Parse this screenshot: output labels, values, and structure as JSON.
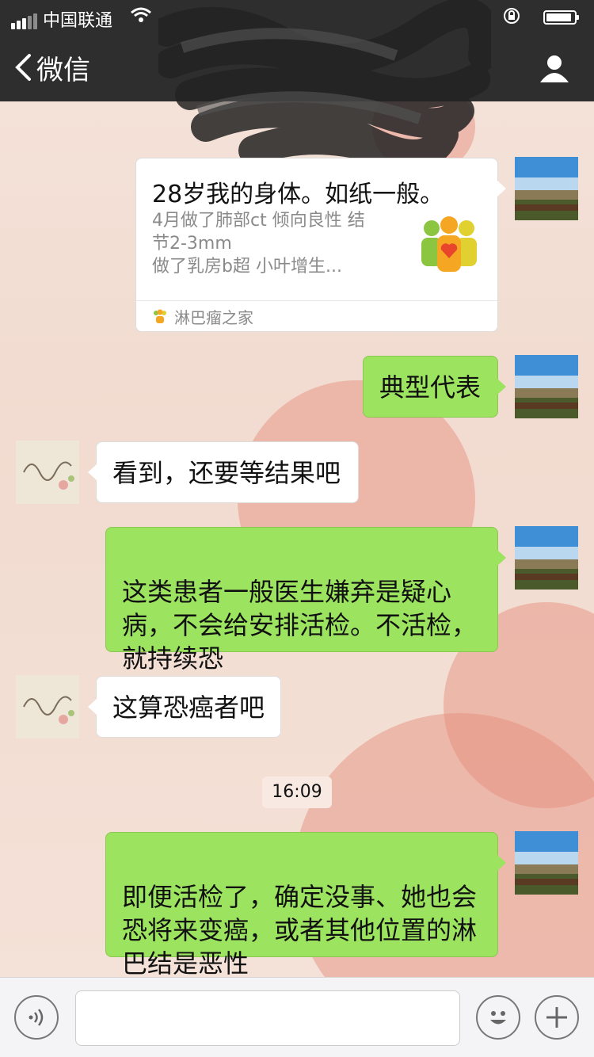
{
  "status_bar": {
    "carrier": "中国联通"
  },
  "nav": {
    "back_label": "微信"
  },
  "messages": {
    "card": {
      "title": "28岁我的身体。如纸一般。",
      "description": "4月做了肺部ct  倾向良性 结\n节2-3mm\n做了乳房b超  小叶增生...",
      "source": "淋巴瘤之家"
    },
    "m1": "典型代表",
    "m2": "看到，还要等结果吧",
    "m3": "这类患者一般医生嫌弃是疑心\n病，不会给安排活检。不活检，\n就持续恐",
    "m4": "这算恐癌者吧",
    "timestamp": "16:09",
    "m5": "即便活检了，确定没事、她也会\n恐将来变癌，或者其他位置的淋\n巴结是恶性"
  },
  "colors": {
    "sent_bubble": "#9ce45f",
    "received_bubble": "#ffffff",
    "topbar": "#2e2e2f"
  }
}
